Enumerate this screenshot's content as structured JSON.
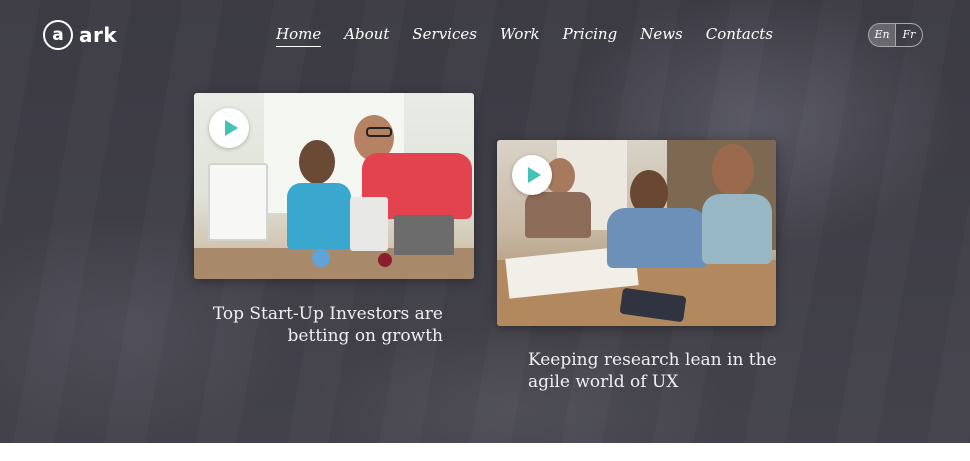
{
  "brand": {
    "logo_letter": "a",
    "logo_text": "ark"
  },
  "nav": {
    "items": [
      {
        "label": "Home",
        "active": true
      },
      {
        "label": "About",
        "active": false
      },
      {
        "label": "Services",
        "active": false
      },
      {
        "label": "Work",
        "active": false
      },
      {
        "label": "Pricing",
        "active": false
      },
      {
        "label": "News",
        "active": false
      },
      {
        "label": "Contacts",
        "active": false
      }
    ]
  },
  "language": {
    "options": [
      "En",
      "Fr"
    ],
    "selected": "En"
  },
  "articles": [
    {
      "title": "Top Start-Up Investors are betting on growth",
      "media": "video-thumbnail"
    },
    {
      "title": "Keeping research lean in the agile world of UX",
      "media": "video-thumbnail"
    }
  ],
  "colors": {
    "background": "#403f48",
    "play_accent": "#44c2b5",
    "text": "#ffffff"
  }
}
